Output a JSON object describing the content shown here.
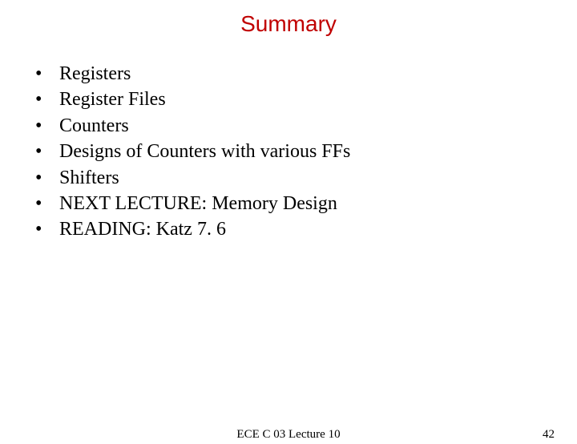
{
  "title": "Summary",
  "items": [
    "Registers",
    "Register Files",
    "Counters",
    "Designs of Counters with various FFs",
    "Shifters",
    "NEXT LECTURE: Memory Design",
    "READING: Katz 7. 6"
  ],
  "footer_center": "ECE C 03 Lecture 10",
  "footer_right": "42"
}
